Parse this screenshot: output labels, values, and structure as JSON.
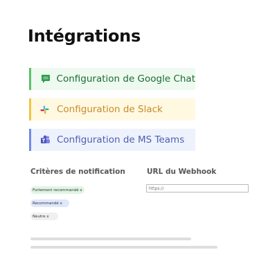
{
  "page": {
    "title": "Intégrations"
  },
  "integrations": [
    {
      "label": "Configuration de Google Chat",
      "icon": "google-chat-icon",
      "accent": "#5ec06c",
      "background": "#eefaf0",
      "text_color": "#1d6b33"
    },
    {
      "label": "Configuration de Slack",
      "icon": "slack-icon",
      "accent": "#f2c443",
      "background": "#fff9e2",
      "text_color": "#c98a2a"
    },
    {
      "label": "Configuration de MS Teams",
      "icon": "ms-teams-icon",
      "accent": "#6b8de8",
      "background": "#eef2fd",
      "text_color": "#4d5fb0"
    }
  ],
  "notifications": {
    "label": "Critères de notification",
    "chips": [
      {
        "label": "Fortement recommandé x",
        "color": "#dff5e4"
      },
      {
        "label": "Recommandé x",
        "color": "#dfe7fb"
      },
      {
        "label": "Neutre x",
        "color": "#f0f0f0"
      }
    ]
  },
  "webhook": {
    "label": "URL du Webhook",
    "placeholder": "https://"
  }
}
